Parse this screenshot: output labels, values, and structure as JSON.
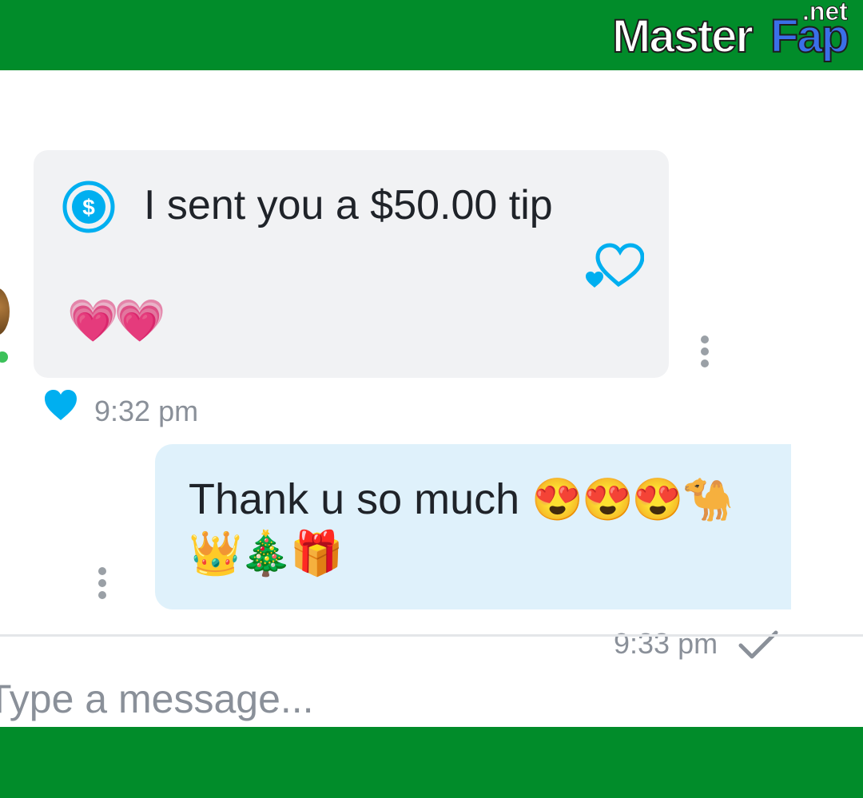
{
  "branding": {
    "logo_master": "Master",
    "logo_fap": "Fap",
    "logo_net": ".net"
  },
  "messages": [
    {
      "direction": "incoming",
      "icon": "dollar-circle-icon",
      "text": "I sent you a $50.00 tip",
      "emojis": "💗💗",
      "reaction_icon": "hearts-icon",
      "liked": true,
      "time": "9:32 pm"
    },
    {
      "direction": "outgoing",
      "text": "Thank u so much",
      "emojis_line1": "😍😍😍🐪",
      "emojis_line2": "👑🎄🎁",
      "time": "9:33 pm",
      "status_icon": "check-icon"
    }
  ],
  "composer": {
    "placeholder": "Type a message..."
  },
  "colors": {
    "bar_green": "#018c2a",
    "accent_blue": "#00aff0",
    "incoming_bubble": "#f1f2f4",
    "outgoing_bubble": "#dff1fb",
    "muted_text": "#8a9099"
  }
}
